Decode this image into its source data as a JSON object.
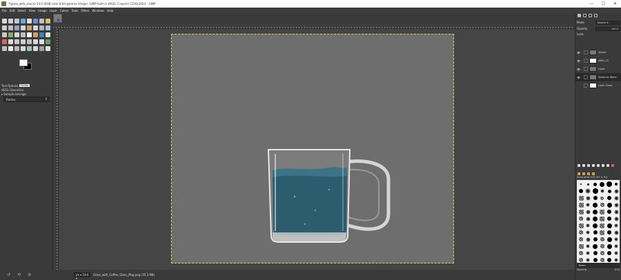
{
  "window": {
    "title": "*[glass_with_sauce]-14.0 (RGB color 8-bit gamma integer, GIMP built-in sRGB, 5 layers) 1256x1024 – GIMP",
    "controls": [
      "—",
      "☐",
      "✕"
    ]
  },
  "menu": [
    "File",
    "Edit",
    "Select",
    "View",
    "Image",
    "Layer",
    "Colors",
    "Tools",
    "Filters",
    "Windows",
    "Help"
  ],
  "colors": {
    "brand_fg": "#ffffff",
    "brand_bg": "#000000",
    "liquid": "#2b5d6f",
    "selection": "#d8d24a"
  },
  "toolbox": {
    "tool_icons": [
      "rect-select-icon",
      "ellipse-select-icon",
      "free-select-icon",
      "fuzzy-select-icon",
      "color-select-icon",
      "scissors-icon",
      "foreground-select-icon",
      "paths-icon",
      "move-icon",
      "align-icon",
      "crop-icon",
      "unified-transform-icon",
      "rotate-icon",
      "scale-icon",
      "shear-icon",
      "perspective-icon",
      "flip-icon",
      "cage-icon",
      "warp-icon",
      "handle-transform-icon",
      "text-icon",
      "bucket-fill-icon",
      "gradient-icon",
      "pencil-icon",
      "paintbrush-icon",
      "eraser-icon",
      "airbrush-icon",
      "ink-icon",
      "mypaint-brush-icon",
      "clone-icon",
      "heal-icon",
      "smudge-icon",
      "blur-icon",
      "dodge-icon",
      "measure-icon",
      "zoom-icon",
      "color-picker-icon",
      "crop-2-icon",
      "gegl-icon",
      "fill-icon"
    ],
    "tab_label": "Tool Options",
    "tab_tooltip": "Pointer",
    "tool_title": "GEGL Operation",
    "sample_label": "Sample average",
    "select_value": "Radius"
  },
  "canvas": {
    "zoom": "px ▾ 19.6 ▾",
    "filename": "Glass_with_Coffee_Glass_Mug.png (35.3 MB)"
  },
  "layers": {
    "mode_label": "Mode",
    "mode_value": "Normal ▾",
    "opacity_label": "Opacity",
    "opacity_value": "100.0",
    "lock_label": "Lock:",
    "items": [
      {
        "name": "Splash",
        "mask": false
      },
      {
        "name": "#6th_CC",
        "mask": true
      },
      {
        "name": "Layer",
        "mask": false
      },
      {
        "name": "Splashes Water",
        "mask": false
      },
      {
        "name": "Layer Glass",
        "mask": true
      }
    ]
  },
  "brushes": {
    "title": "Airbrushes 015 (51 × 51)",
    "selected": "Basic,",
    "spacing_label": "Spacing",
    "spacing_value": "10.0"
  }
}
